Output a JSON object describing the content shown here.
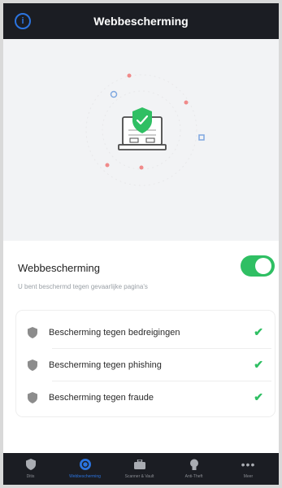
{
  "header": {
    "title": "Webbescherming",
    "info_icon": "info-icon"
  },
  "setting": {
    "title": "Webbescherming",
    "subtitle": "U bent beschermd tegen gevaarlijke pagina's",
    "enabled": true,
    "accent": "#2fbf63"
  },
  "protections": [
    {
      "label": "Bescherming tegen bedreigingen",
      "status": "enabled"
    },
    {
      "label": "Bescherming tegen phishing",
      "status": "enabled"
    },
    {
      "label": "Bescherming tegen fraude",
      "status": "enabled"
    }
  ],
  "tabs": [
    {
      "label": "Ditis",
      "icon": "shield-icon",
      "active": false
    },
    {
      "label": "Webbescherming",
      "icon": "globe-icon",
      "active": true
    },
    {
      "label": "Scanner & Vault",
      "icon": "briefcase-icon",
      "active": false
    },
    {
      "label": "Anti-Theft",
      "icon": "bulb-icon",
      "active": false
    },
    {
      "label": "Meer",
      "icon": "more-icon",
      "active": false
    }
  ],
  "colors": {
    "header_bg": "#1b1d23",
    "active_tab": "#2b74e0",
    "check_green": "#2fbf63"
  }
}
